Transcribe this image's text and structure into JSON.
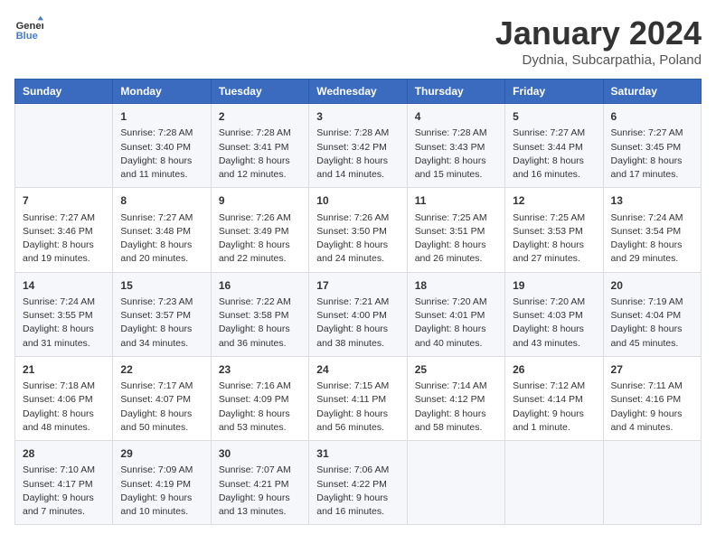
{
  "header": {
    "logo_line1": "General",
    "logo_line2": "Blue",
    "month_title": "January 2024",
    "subtitle": "Dydnia, Subcarpathia, Poland"
  },
  "columns": [
    "Sunday",
    "Monday",
    "Tuesday",
    "Wednesday",
    "Thursday",
    "Friday",
    "Saturday"
  ],
  "weeks": [
    [
      {
        "day": "",
        "info": ""
      },
      {
        "day": "1",
        "info": "Sunrise: 7:28 AM\nSunset: 3:40 PM\nDaylight: 8 hours\nand 11 minutes."
      },
      {
        "day": "2",
        "info": "Sunrise: 7:28 AM\nSunset: 3:41 PM\nDaylight: 8 hours\nand 12 minutes."
      },
      {
        "day": "3",
        "info": "Sunrise: 7:28 AM\nSunset: 3:42 PM\nDaylight: 8 hours\nand 14 minutes."
      },
      {
        "day": "4",
        "info": "Sunrise: 7:28 AM\nSunset: 3:43 PM\nDaylight: 8 hours\nand 15 minutes."
      },
      {
        "day": "5",
        "info": "Sunrise: 7:27 AM\nSunset: 3:44 PM\nDaylight: 8 hours\nand 16 minutes."
      },
      {
        "day": "6",
        "info": "Sunrise: 7:27 AM\nSunset: 3:45 PM\nDaylight: 8 hours\nand 17 minutes."
      }
    ],
    [
      {
        "day": "7",
        "info": "Sunrise: 7:27 AM\nSunset: 3:46 PM\nDaylight: 8 hours\nand 19 minutes."
      },
      {
        "day": "8",
        "info": "Sunrise: 7:27 AM\nSunset: 3:48 PM\nDaylight: 8 hours\nand 20 minutes."
      },
      {
        "day": "9",
        "info": "Sunrise: 7:26 AM\nSunset: 3:49 PM\nDaylight: 8 hours\nand 22 minutes."
      },
      {
        "day": "10",
        "info": "Sunrise: 7:26 AM\nSunset: 3:50 PM\nDaylight: 8 hours\nand 24 minutes."
      },
      {
        "day": "11",
        "info": "Sunrise: 7:25 AM\nSunset: 3:51 PM\nDaylight: 8 hours\nand 26 minutes."
      },
      {
        "day": "12",
        "info": "Sunrise: 7:25 AM\nSunset: 3:53 PM\nDaylight: 8 hours\nand 27 minutes."
      },
      {
        "day": "13",
        "info": "Sunrise: 7:24 AM\nSunset: 3:54 PM\nDaylight: 8 hours\nand 29 minutes."
      }
    ],
    [
      {
        "day": "14",
        "info": "Sunrise: 7:24 AM\nSunset: 3:55 PM\nDaylight: 8 hours\nand 31 minutes."
      },
      {
        "day": "15",
        "info": "Sunrise: 7:23 AM\nSunset: 3:57 PM\nDaylight: 8 hours\nand 34 minutes."
      },
      {
        "day": "16",
        "info": "Sunrise: 7:22 AM\nSunset: 3:58 PM\nDaylight: 8 hours\nand 36 minutes."
      },
      {
        "day": "17",
        "info": "Sunrise: 7:21 AM\nSunset: 4:00 PM\nDaylight: 8 hours\nand 38 minutes."
      },
      {
        "day": "18",
        "info": "Sunrise: 7:20 AM\nSunset: 4:01 PM\nDaylight: 8 hours\nand 40 minutes."
      },
      {
        "day": "19",
        "info": "Sunrise: 7:20 AM\nSunset: 4:03 PM\nDaylight: 8 hours\nand 43 minutes."
      },
      {
        "day": "20",
        "info": "Sunrise: 7:19 AM\nSunset: 4:04 PM\nDaylight: 8 hours\nand 45 minutes."
      }
    ],
    [
      {
        "day": "21",
        "info": "Sunrise: 7:18 AM\nSunset: 4:06 PM\nDaylight: 8 hours\nand 48 minutes."
      },
      {
        "day": "22",
        "info": "Sunrise: 7:17 AM\nSunset: 4:07 PM\nDaylight: 8 hours\nand 50 minutes."
      },
      {
        "day": "23",
        "info": "Sunrise: 7:16 AM\nSunset: 4:09 PM\nDaylight: 8 hours\nand 53 minutes."
      },
      {
        "day": "24",
        "info": "Sunrise: 7:15 AM\nSunset: 4:11 PM\nDaylight: 8 hours\nand 56 minutes."
      },
      {
        "day": "25",
        "info": "Sunrise: 7:14 AM\nSunset: 4:12 PM\nDaylight: 8 hours\nand 58 minutes."
      },
      {
        "day": "26",
        "info": "Sunrise: 7:12 AM\nSunset: 4:14 PM\nDaylight: 9 hours\nand 1 minute."
      },
      {
        "day": "27",
        "info": "Sunrise: 7:11 AM\nSunset: 4:16 PM\nDaylight: 9 hours\nand 4 minutes."
      }
    ],
    [
      {
        "day": "28",
        "info": "Sunrise: 7:10 AM\nSunset: 4:17 PM\nDaylight: 9 hours\nand 7 minutes."
      },
      {
        "day": "29",
        "info": "Sunrise: 7:09 AM\nSunset: 4:19 PM\nDaylight: 9 hours\nand 10 minutes."
      },
      {
        "day": "30",
        "info": "Sunrise: 7:07 AM\nSunset: 4:21 PM\nDaylight: 9 hours\nand 13 minutes."
      },
      {
        "day": "31",
        "info": "Sunrise: 7:06 AM\nSunset: 4:22 PM\nDaylight: 9 hours\nand 16 minutes."
      },
      {
        "day": "",
        "info": ""
      },
      {
        "day": "",
        "info": ""
      },
      {
        "day": "",
        "info": ""
      }
    ]
  ]
}
